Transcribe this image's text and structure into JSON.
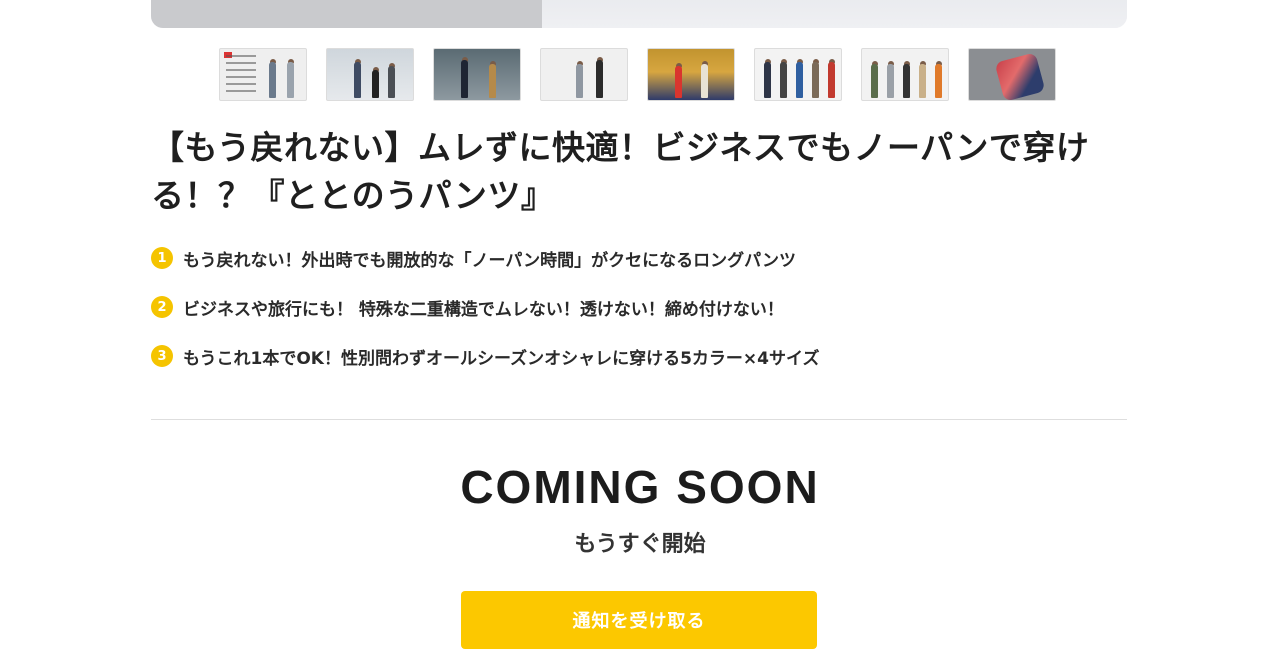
{
  "gallery": {
    "thumbnail_count": 8,
    "thumbnail_descriptions": [
      "promo-cover-thumbnail",
      "office-scene-thumbnail",
      "city-scene-thumbnail",
      "studio-scene-thumbnail",
      "colorful-scene-thumbnail",
      "lineup-scene-thumbnail",
      "color-lineup-thumbnail",
      "fabric-detail-thumbnail"
    ]
  },
  "product": {
    "title": "【もう戻れない】ムレずに快適！ビジネスでもノーパンで穿ける！？『ととのうパンツ』",
    "features": [
      {
        "number": "1",
        "text": "もう戻れない！外出時でも開放的な「ノーパン時間」がクセになるロングパンツ"
      },
      {
        "number": "2",
        "text": "ビジネスや旅行にも！ 特殊な二重構造でムレない！透けない！締め付けない！"
      },
      {
        "number": "3",
        "text": "もうこれ1本でOK！性別問わずオールシーズンオシャレに穿ける5カラー×4サイズ"
      }
    ]
  },
  "status": {
    "heading": "COMING SOON",
    "subheading": "もうすぐ開始",
    "notify_button_label": "通知を受け取る"
  },
  "colors": {
    "accent": "#fcc800",
    "feature_badge": "#f5c400",
    "text": "#1f1f1f"
  }
}
